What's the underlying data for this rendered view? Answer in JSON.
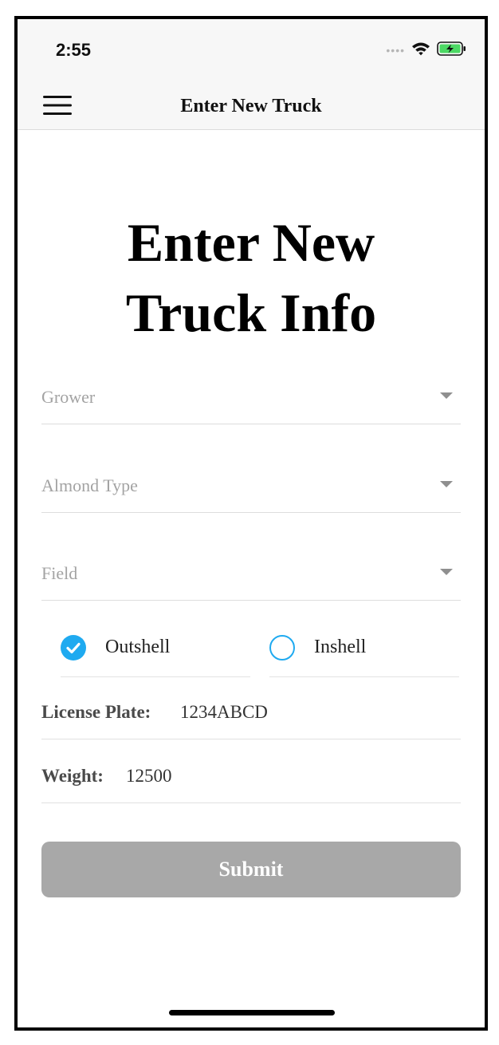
{
  "status_bar": {
    "time": "2:55",
    "signal_icon": "signal-dots-icon",
    "wifi_icon": "wifi-icon",
    "battery_icon": "battery-charging-icon",
    "battery_color": "#4cd964"
  },
  "nav": {
    "menu_icon": "hamburger-menu-icon",
    "title": "Enter New Truck"
  },
  "page": {
    "title_line1": "Enter New",
    "title_line2": "Truck Info"
  },
  "dropdowns": [
    {
      "label": "Grower"
    },
    {
      "label": "Almond Type"
    },
    {
      "label": "Field"
    }
  ],
  "shell_type": {
    "options": [
      {
        "label": "Outshell",
        "checked": true
      },
      {
        "label": "Inshell",
        "checked": false
      }
    ],
    "accent_color": "#1faaf0"
  },
  "fields": {
    "license_plate": {
      "label": "License Plate:",
      "value": "1234ABCD"
    },
    "weight": {
      "label": "Weight:",
      "value": "12500"
    }
  },
  "submit": {
    "label": "Submit",
    "color": "#a8a8a8"
  }
}
